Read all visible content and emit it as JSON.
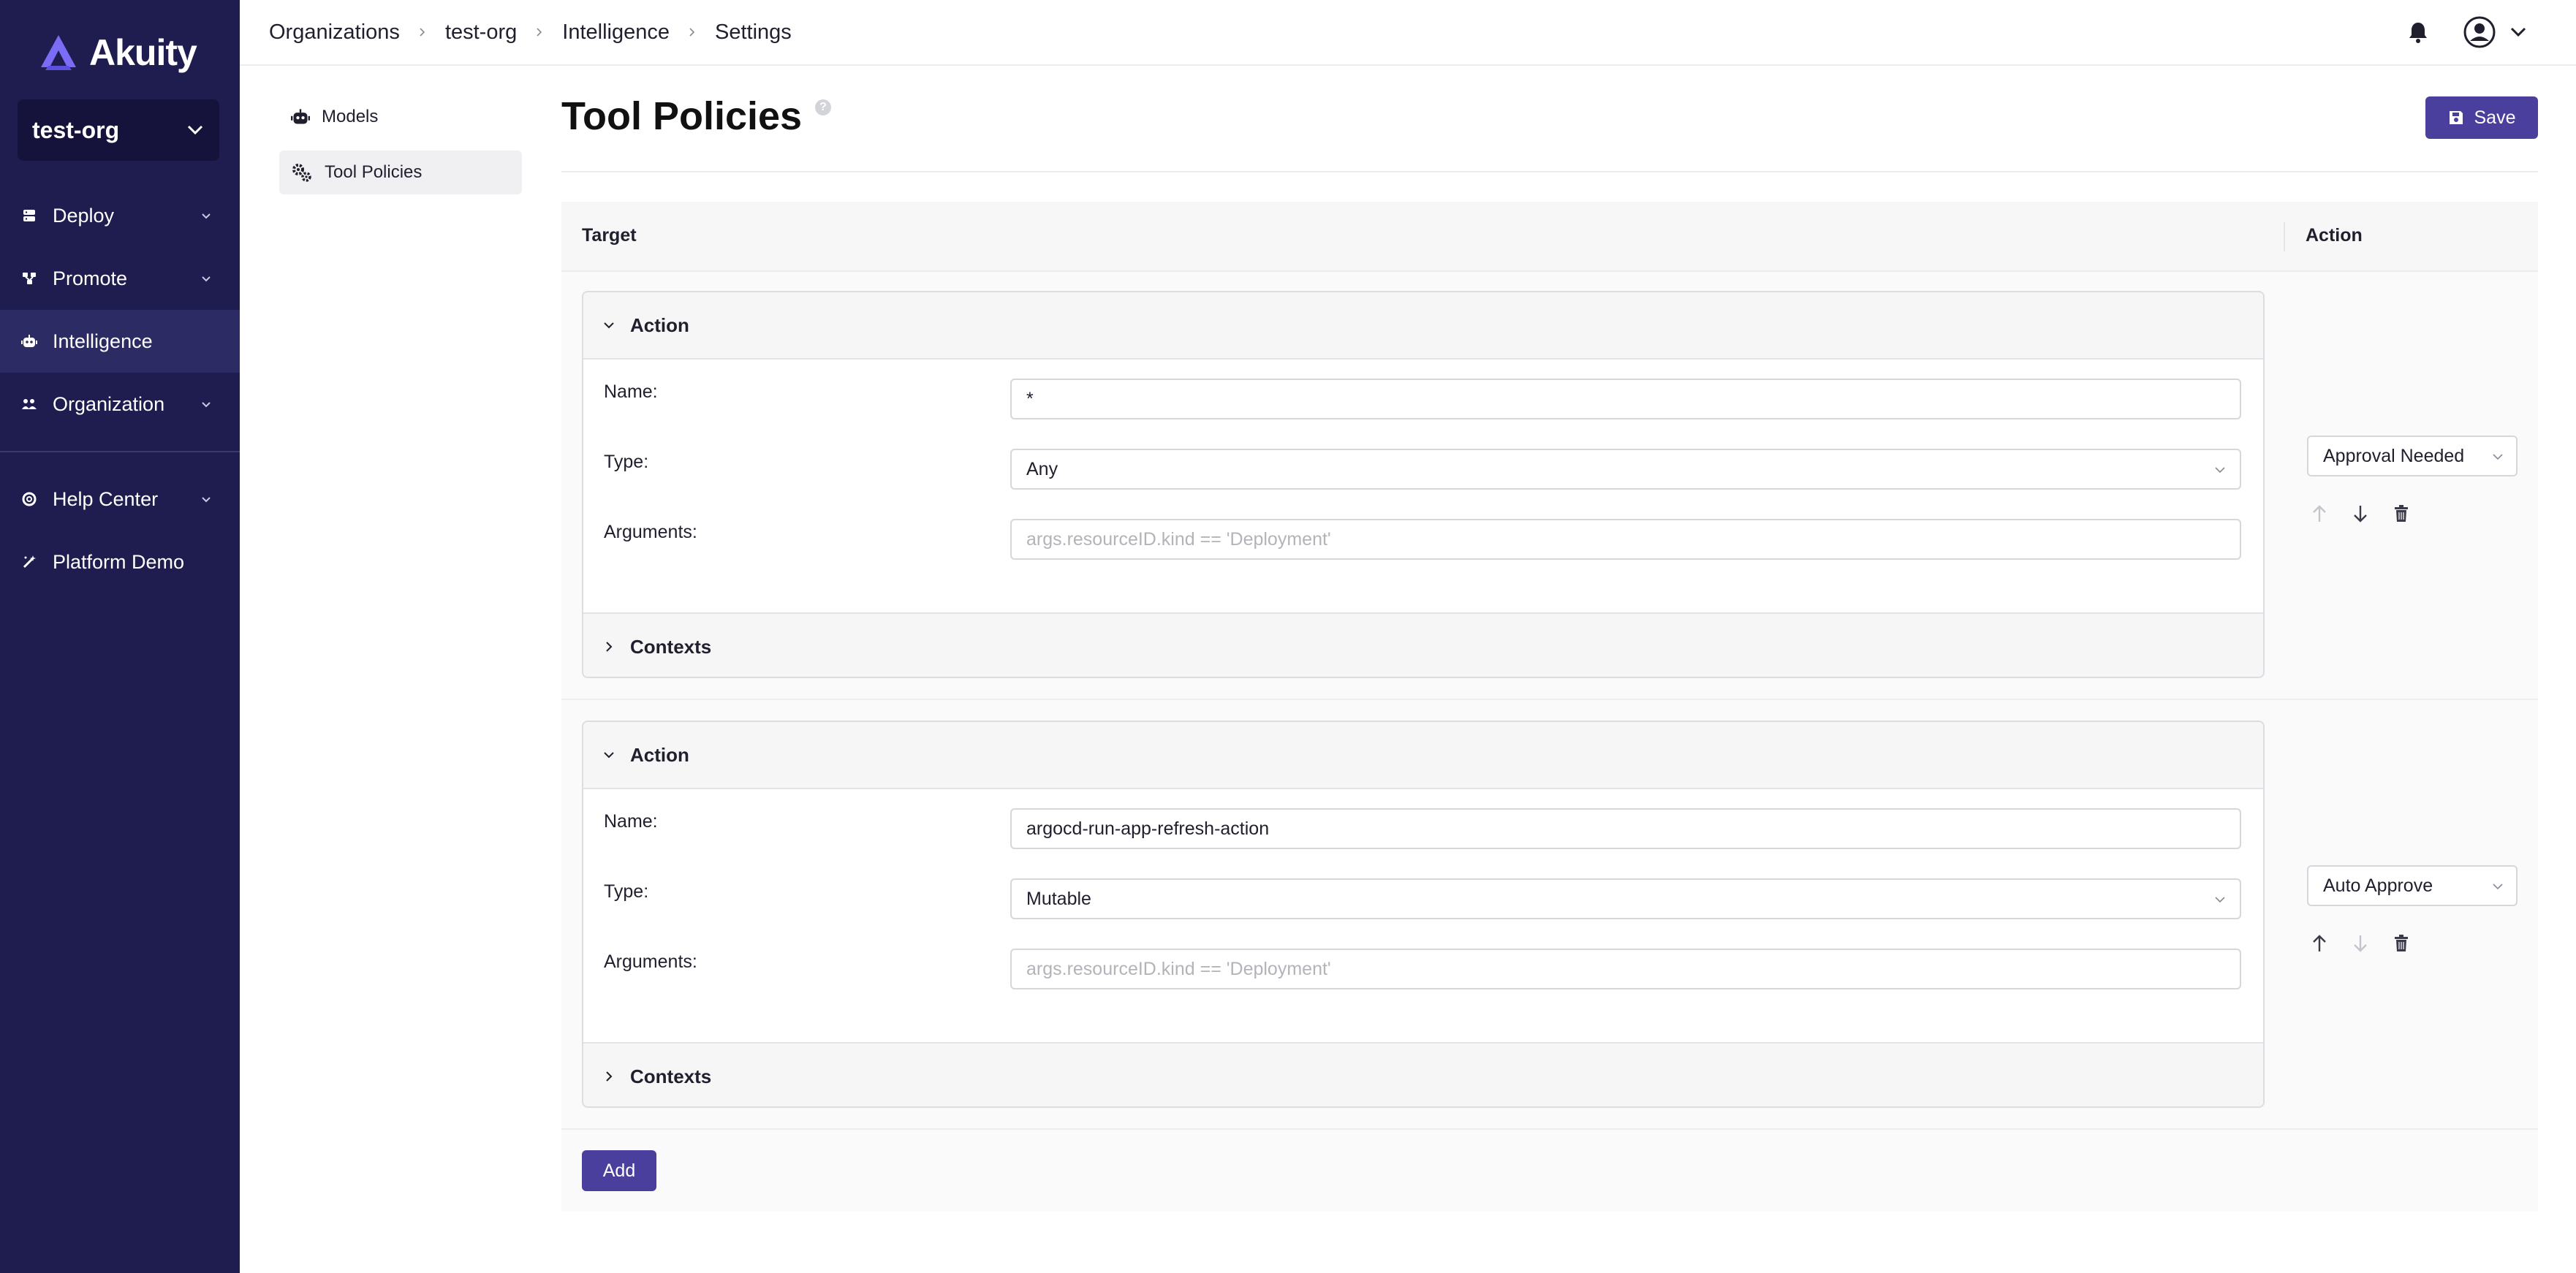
{
  "brand": {
    "name": "Akuity"
  },
  "org_selector": {
    "value": "test-org"
  },
  "sidebar": {
    "items": [
      {
        "label": "Deploy",
        "icon": "server-icon",
        "expandable": true
      },
      {
        "label": "Promote",
        "icon": "flow-icon",
        "expandable": true
      },
      {
        "label": "Intelligence",
        "icon": "robot-icon",
        "expandable": false,
        "active": true
      },
      {
        "label": "Organization",
        "icon": "team-icon",
        "expandable": true
      },
      {
        "label": "Help Center",
        "icon": "lifebuoy-icon",
        "expandable": true
      },
      {
        "label": "Platform Demo",
        "icon": "magic-wand-icon",
        "expandable": false
      }
    ]
  },
  "breadcrumb": [
    "Organizations",
    "test-org",
    "Intelligence",
    "Settings"
  ],
  "subnav": {
    "items": [
      {
        "label": "Models",
        "icon": "robot-icon"
      },
      {
        "label": "Tool Policies",
        "icon": "gears-icon",
        "active": true
      }
    ]
  },
  "page": {
    "title": "Tool Policies",
    "help": "?",
    "save_label": "Save"
  },
  "table": {
    "headers": {
      "target": "Target",
      "action": "Action"
    },
    "rows": [
      {
        "section_title": "Action",
        "name_label": "Name:",
        "name_value": "*",
        "type_label": "Type:",
        "type_value": "Any",
        "args_label": "Arguments:",
        "args_placeholder": "args.resourceID.kind == 'Deployment'",
        "contexts_label": "Contexts",
        "action_value": "Approval Needed"
      },
      {
        "section_title": "Action",
        "name_label": "Name:",
        "name_value": "argocd-run-app-refresh-action",
        "type_label": "Type:",
        "type_value": "Mutable",
        "args_label": "Arguments:",
        "args_placeholder": "args.resourceID.kind == 'Deployment'",
        "contexts_label": "Contexts",
        "action_value": "Auto Approve"
      }
    ],
    "add_label": "Add"
  },
  "colors": {
    "sidebar_bg": "#1f1d4f",
    "primary": "#4b3f9e",
    "logo_accent": "#7b6cf6"
  }
}
